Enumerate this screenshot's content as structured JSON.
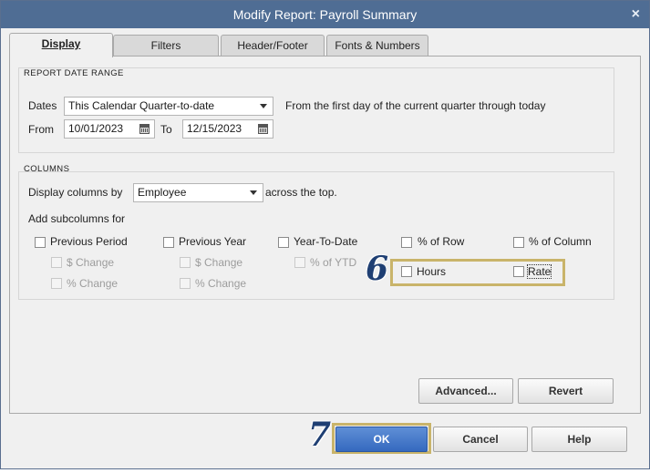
{
  "window": {
    "title": "Modify Report: Payroll Summary",
    "close_glyph": "×"
  },
  "tabs": [
    {
      "label": "Display",
      "active": true
    },
    {
      "label": "Filters",
      "active": false
    },
    {
      "label": "Header/Footer",
      "active": false
    },
    {
      "label": "Fonts & Numbers",
      "active": false
    }
  ],
  "report_date_range": {
    "title": "REPORT DATE RANGE",
    "dates_label": "Dates",
    "dates_value": "This Calendar Quarter-to-date",
    "dates_description": "From the first day of the current quarter through today",
    "from_label": "From",
    "from_value": "10/01/2023",
    "to_label": "To",
    "to_value": "12/15/2023"
  },
  "columns": {
    "title": "COLUMNS",
    "display_columns_label": "Display columns by",
    "display_columns_value": "Employee",
    "across_label": "across the top.",
    "add_subcolumns_label": "Add subcolumns for",
    "subcolumns": {
      "previous_period": "Previous Period",
      "previous_year": "Previous Year",
      "year_to_date": "Year-To-Date",
      "pct_of_row": "% of Row",
      "pct_of_column": "% of Column",
      "pp_dollar_change": "$ Change",
      "pp_pct_change": "% Change",
      "py_dollar_change": "$ Change",
      "py_pct_change": "% Change",
      "pct_of_ytd": "% of YTD",
      "hours": "Hours",
      "rate": "Rate"
    }
  },
  "buttons": {
    "advanced": "Advanced...",
    "revert": "Revert",
    "ok": "OK",
    "cancel": "Cancel",
    "help": "Help"
  },
  "callouts": {
    "step_6": "6",
    "step_7": "7",
    "highlight_color": "#c9b46a",
    "number_color": "#1f3f73"
  },
  "colors": {
    "titlebar": "#4f6d94",
    "ok_button": "#3569bf",
    "dialog_background": "#f0f0f0"
  }
}
